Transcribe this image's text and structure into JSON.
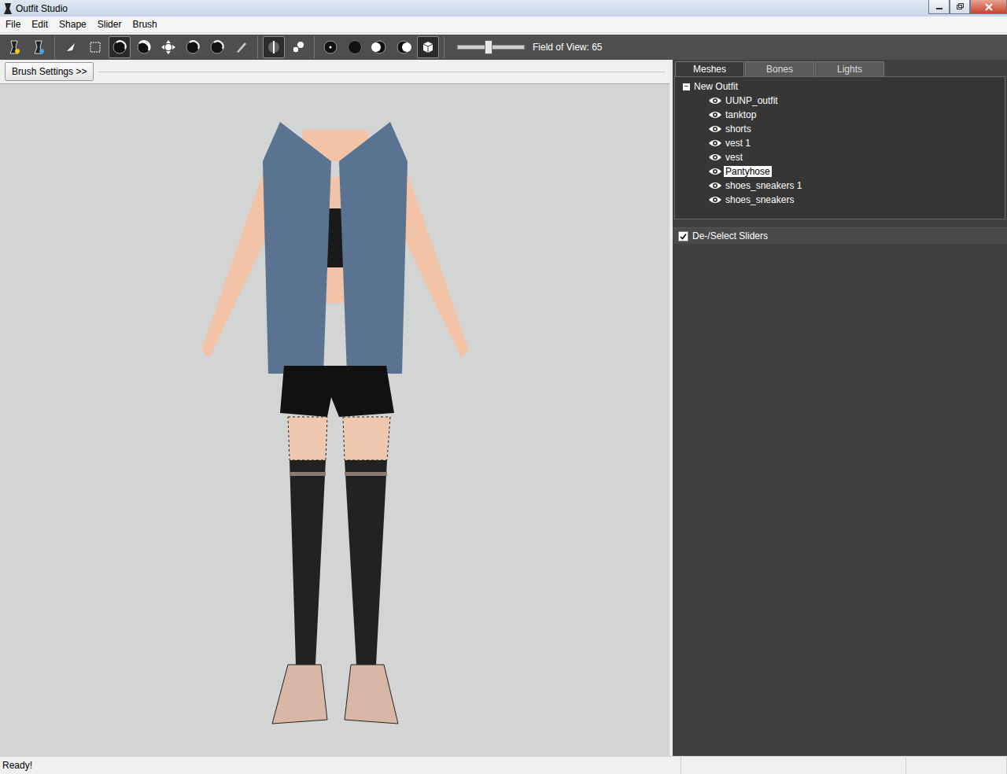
{
  "window": {
    "title": "Outfit Studio"
  },
  "menu": [
    "File",
    "Edit",
    "Shape",
    "Slider",
    "Brush"
  ],
  "toolbar": {
    "groups": [
      [
        {
          "kind": "new",
          "selected": false
        },
        {
          "kind": "load",
          "selected": false
        }
      ],
      [
        {
          "kind": "select",
          "selected": false
        },
        {
          "kind": "mask",
          "selected": false
        },
        {
          "kind": "inflate",
          "selected": true
        },
        {
          "kind": "deflate",
          "selected": false
        },
        {
          "kind": "move",
          "selected": false
        },
        {
          "kind": "smooth",
          "selected": false
        },
        {
          "kind": "weight",
          "selected": false
        },
        {
          "kind": "color",
          "selected": false
        }
      ],
      [
        {
          "kind": "mirror",
          "selected": true
        },
        {
          "kind": "connected",
          "selected": false
        }
      ],
      [
        {
          "kind": "front",
          "selected": false
        },
        {
          "kind": "back",
          "selected": false
        },
        {
          "kind": "left",
          "selected": false
        },
        {
          "kind": "right",
          "selected": false
        },
        {
          "kind": "perspective",
          "selected": true
        }
      ]
    ],
    "fov": {
      "level": 0.45,
      "label": "Field of View: 65"
    }
  },
  "brush_settings": {
    "label": "Brush Settings >>"
  },
  "tabs": [
    {
      "label": "Meshes",
      "selected": true
    },
    {
      "label": "Bones",
      "selected": false
    },
    {
      "label": "Lights",
      "selected": false
    }
  ],
  "tree": {
    "root": "New Outfit",
    "expanded": true,
    "expander": "−",
    "items": [
      {
        "label": "UUNP_outfit",
        "selected": false,
        "visible": true
      },
      {
        "label": "tanktop",
        "selected": false,
        "visible": true
      },
      {
        "label": "shorts",
        "selected": false,
        "visible": true
      },
      {
        "label": "vest 1",
        "selected": false,
        "visible": true
      },
      {
        "label": "vest",
        "selected": false,
        "visible": true
      },
      {
        "label": "Pantyhose",
        "selected": true,
        "visible": true
      },
      {
        "label": "shoes_sneakers 1",
        "selected": false,
        "visible": true
      },
      {
        "label": "shoes_sneakers",
        "selected": false,
        "visible": true
      }
    ]
  },
  "sliders_toggle": {
    "label": "De-/Select Sliders",
    "checked": true
  },
  "status_bar": "Ready!"
}
